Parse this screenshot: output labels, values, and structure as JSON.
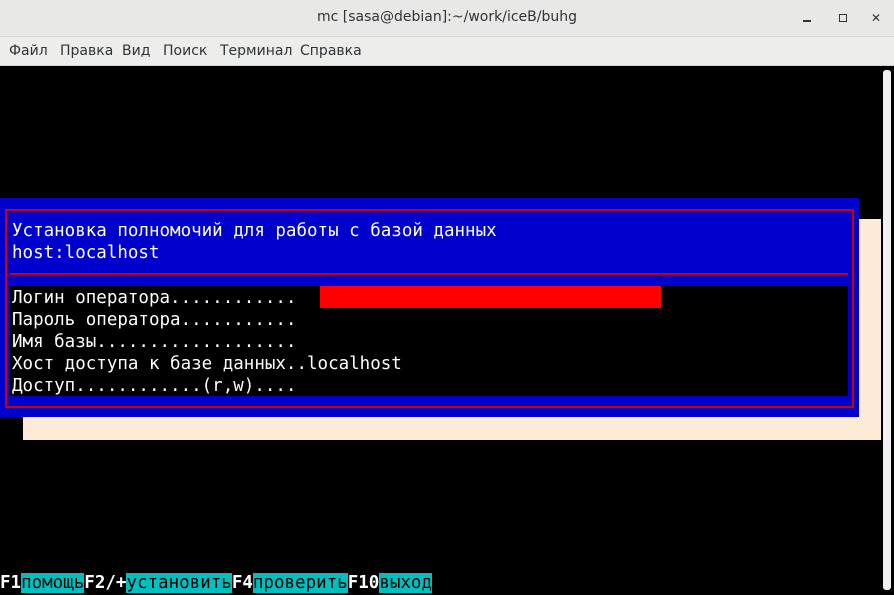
{
  "window": {
    "title": "mc [sasa@debian]:~/work/iceB/buhg"
  },
  "menu": [
    "Файл",
    "Правка",
    "Вид",
    "Поиск",
    "Терминал",
    "Справка"
  ],
  "dialog": {
    "title": "Установка полномочий для работы с базой данных",
    "host": "host:localhost",
    "fields": [
      "Логин оператора............",
      "Пароль оператора...........",
      "Имя базы...................",
      "Хост доступа к базе данных..localhost",
      "Доступ............(r,w)...."
    ]
  },
  "fkeys": [
    {
      "key": "F1",
      "label": "помощь"
    },
    {
      "key": "F2/+",
      "label": "установить"
    },
    {
      "key": "F4",
      "label": "проверить"
    },
    {
      "key": "F10",
      "label": "выход"
    }
  ],
  "colors": {
    "dialog_bg": "#0000cc",
    "frame": "#cc0000",
    "input_highlight": "#ff0000",
    "shadow": "#fdebd8",
    "fkey_label_bg": "#00bfbf"
  }
}
